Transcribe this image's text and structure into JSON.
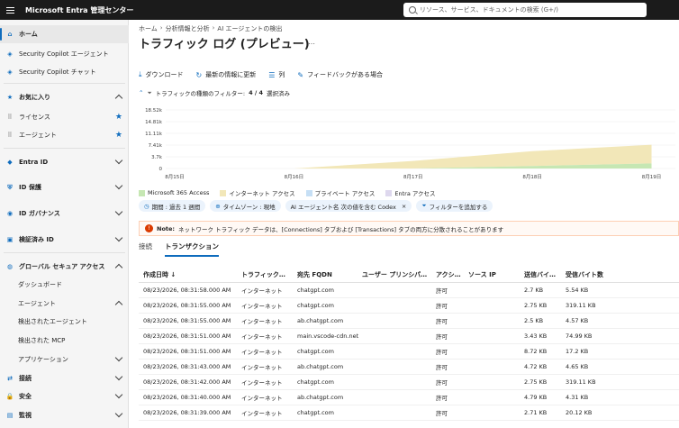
{
  "app": {
    "title": "Microsoft Entra 管理センター",
    "search_placeholder": "リソース、サービス、ドキュメントの検索 (G+/)"
  },
  "sidebar": {
    "items": [
      {
        "label": "ホーム",
        "icon": "home-icon",
        "glyph": "⌂",
        "type": "active"
      },
      {
        "label": "Security Copilot エージェント",
        "icon": "copilot-icon",
        "glyph": "◈",
        "type": "item"
      },
      {
        "label": "Security Copilot チャット",
        "icon": "copilot-icon",
        "glyph": "◈",
        "type": "item"
      },
      {
        "label": "お気に入り",
        "icon": "star-icon",
        "glyph": "★",
        "type": "group-up"
      },
      {
        "label": "ライセンス",
        "icon": "drag-handle-icon",
        "glyph": "⠿",
        "type": "fav"
      },
      {
        "label": "エージェント",
        "icon": "drag-handle-icon",
        "glyph": "⠿",
        "type": "fav"
      },
      {
        "label": "Entra ID",
        "icon": "diamond-icon",
        "glyph": "◆",
        "type": "group-down"
      },
      {
        "label": "ID 保護",
        "icon": "shield-icon",
        "glyph": "⛨",
        "type": "group-down"
      },
      {
        "label": "ID ガバナンス",
        "icon": "governance-icon",
        "glyph": "◉",
        "type": "group-down"
      },
      {
        "label": "検証済み ID",
        "icon": "verified-icon",
        "glyph": "▣",
        "type": "group-down"
      },
      {
        "label": "グローバル セキュア アクセス",
        "icon": "globe-icon",
        "glyph": "◍",
        "type": "group-up"
      },
      {
        "label": "ダッシュボード",
        "icon": "",
        "glyph": "",
        "type": "sub"
      },
      {
        "label": "エージェント",
        "icon": "",
        "glyph": "",
        "type": "sub-up"
      },
      {
        "label": "検出されたエージェント",
        "icon": "",
        "glyph": "",
        "type": "sub"
      },
      {
        "label": "検出された MCP",
        "icon": "",
        "glyph": "",
        "type": "sub"
      },
      {
        "label": "アプリケーション",
        "icon": "",
        "glyph": "",
        "type": "sub-down"
      },
      {
        "label": "接続",
        "icon": "connect-icon",
        "glyph": "⇄",
        "type": "group-down"
      },
      {
        "label": "安全",
        "icon": "lock-icon",
        "glyph": "🔒",
        "type": "group-down"
      },
      {
        "label": "監視",
        "icon": "monitor-icon",
        "glyph": "▤",
        "type": "group-down"
      }
    ]
  },
  "breadcrumb": [
    "ホーム",
    "分析情報と分析",
    "AI エージェントの検出"
  ],
  "page": {
    "title": "トラフィック ログ (プレビュー)",
    "more": "…"
  },
  "toolbar": {
    "download": "ダウンロード",
    "refresh": "最新の情報に更新",
    "columns": "列",
    "feedback": "フィードバックがある場合"
  },
  "filter_summary": {
    "label": "トラフィックの種類のフィルター:",
    "count": "4 / 4",
    "suffix": "選択済み"
  },
  "chart_data": {
    "type": "area",
    "x": [
      "8月15日",
      "8月16日",
      "8月17日",
      "8月18日",
      "8月19日"
    ],
    "yticks": [
      "18.52k",
      "14.81k",
      "11.11k",
      "7.41k",
      "3.7k",
      "0"
    ],
    "ylim": [
      0,
      18520
    ],
    "series": [
      {
        "name": "Microsoft 365 Access",
        "color": "#c6e7b3",
        "values": [
          0,
          0,
          0,
          800,
          1600
        ]
      },
      {
        "name": "インターネット アクセス",
        "color": "#f2e7b8",
        "values": [
          0,
          0,
          2400,
          4700,
          5900
        ]
      },
      {
        "name": "プライベート アクセス",
        "color": "#c6dff5",
        "values": [
          0,
          0,
          0,
          0,
          0
        ]
      },
      {
        "name": "Entra アクセス",
        "color": "#ded8ee",
        "values": [
          0,
          0,
          0,
          0,
          0
        ]
      }
    ],
    "grid": true
  },
  "pills": [
    {
      "icon": "clock-icon",
      "glyph": "◷",
      "label": "期間 : 過去 1 週間"
    },
    {
      "icon": "globe-icon",
      "glyph": "⊕",
      "label": "タイムゾーン : 現地"
    },
    {
      "icon": "",
      "glyph": "",
      "label": "AI エージェント名 次の値を含む Codex",
      "close": "×"
    },
    {
      "icon": "filter-icon",
      "glyph": "⏷",
      "label": "フィルターを追加する"
    }
  ],
  "note": {
    "label": "Note:",
    "text": "ネットワーク トラフィック データは、[Connections] タブおよび [Transactions] タブの両方に分散されることがあります"
  },
  "tabs": [
    "接続",
    "トランザクション"
  ],
  "table": {
    "headers": [
      "作成日時 ↓",
      "トラフィック…",
      "宛先 FQDN",
      "ユーザー プリンシパ…",
      "アクシ…",
      "ソース IP",
      "送信バイ…",
      "受信バイト数"
    ],
    "rows": [
      [
        "08/23/2026, 08:31:58.000 AM",
        "インターネット",
        "chatgpt.com",
        "",
        "許可",
        "",
        "2.7 KB",
        "5.54 KB"
      ],
      [
        "08/23/2026, 08:31:55.000 AM",
        "インターネット",
        "chatgpt.com",
        "",
        "許可",
        "",
        "2.75 KB",
        "319.11 KB"
      ],
      [
        "08/23/2026, 08:31:55.000 AM",
        "インターネット",
        "ab.chatgpt.com",
        "",
        "許可",
        "",
        "2.5 KB",
        "4.57 KB"
      ],
      [
        "08/23/2026, 08:31:51.000 AM",
        "インターネット",
        "main.vscode-cdn.net",
        "",
        "許可",
        "",
        "3.43 KB",
        "74.99 KB"
      ],
      [
        "08/23/2026, 08:31:51.000 AM",
        "インターネット",
        "chatgpt.com",
        "",
        "許可",
        "",
        "8.72 KB",
        "17.2 KB"
      ],
      [
        "08/23/2026, 08:31:43.000 AM",
        "インターネット",
        "ab.chatgpt.com",
        "",
        "許可",
        "",
        "4.72 KB",
        "4.65 KB"
      ],
      [
        "08/23/2026, 08:31:42.000 AM",
        "インターネット",
        "chatgpt.com",
        "",
        "許可",
        "",
        "2.75 KB",
        "319.11 KB"
      ],
      [
        "08/23/2026, 08:31:40.000 AM",
        "インターネット",
        "ab.chatgpt.com",
        "",
        "許可",
        "",
        "4.79 KB",
        "4.31 KB"
      ],
      [
        "08/23/2026, 08:31:39.000 AM",
        "インターネット",
        "chatgpt.com",
        "",
        "許可",
        "",
        "2.71 KB",
        "20.12 KB"
      ]
    ]
  }
}
